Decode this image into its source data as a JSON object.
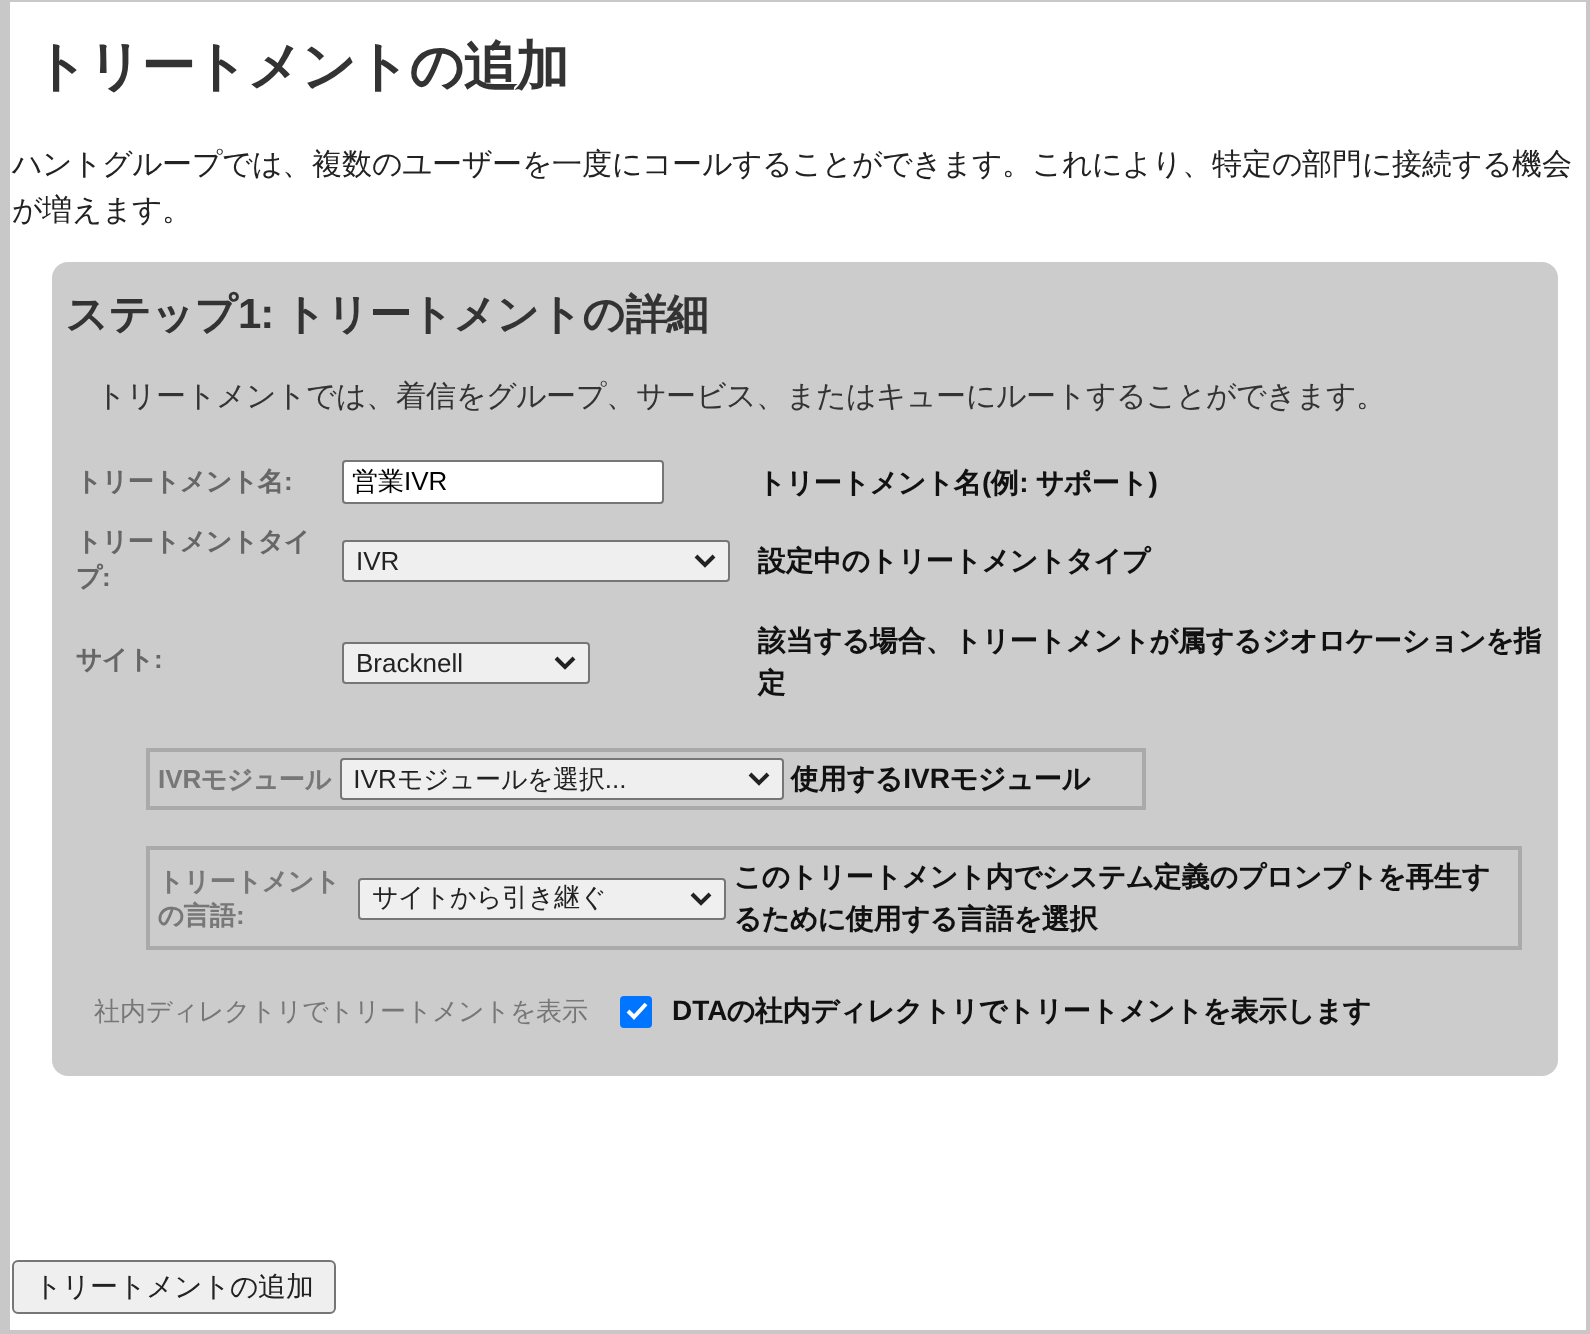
{
  "title": "トリートメントの追加",
  "intro": "ハントグループでは、複数のユーザーを一度にコールすることができます。これにより、特定の部門に接続する機会が増えます。",
  "step": {
    "heading": "ステップ1: トリートメントの詳細",
    "description": "トリートメントでは、着信をグループ、サービス、またはキューにルートすることができます。",
    "fields": [
      {
        "kind": "text",
        "label": "トリートメント名:",
        "value": "営業IVR",
        "help": "トリートメント名(例: サポート)"
      },
      {
        "kind": "select",
        "label": "トリートメントタイプ:",
        "value": "IVR",
        "help": "設定中のトリートメントタイプ"
      },
      {
        "kind": "select",
        "label": "サイト:",
        "value": "Bracknell",
        "help": "該当する場合、トリートメントが属するジオロケーションを指定"
      }
    ],
    "boxed": [
      {
        "label": "IVRモジュール",
        "value": "IVRモジュールを選択...",
        "help": "使用するIVRモジュール"
      },
      {
        "label": "トリートメントの言語:",
        "value": "サイトから引き継ぐ",
        "help": "このトリートメント内でシステム定義のプロンプトを再生するために使用する言語を選択"
      }
    ],
    "directory": {
      "label": "社内ディレクトリでトリートメントを表示",
      "checked": true,
      "help": "DTAの社内ディレクトリでトリートメントを表示します"
    }
  },
  "submit": "トリートメントの追加"
}
